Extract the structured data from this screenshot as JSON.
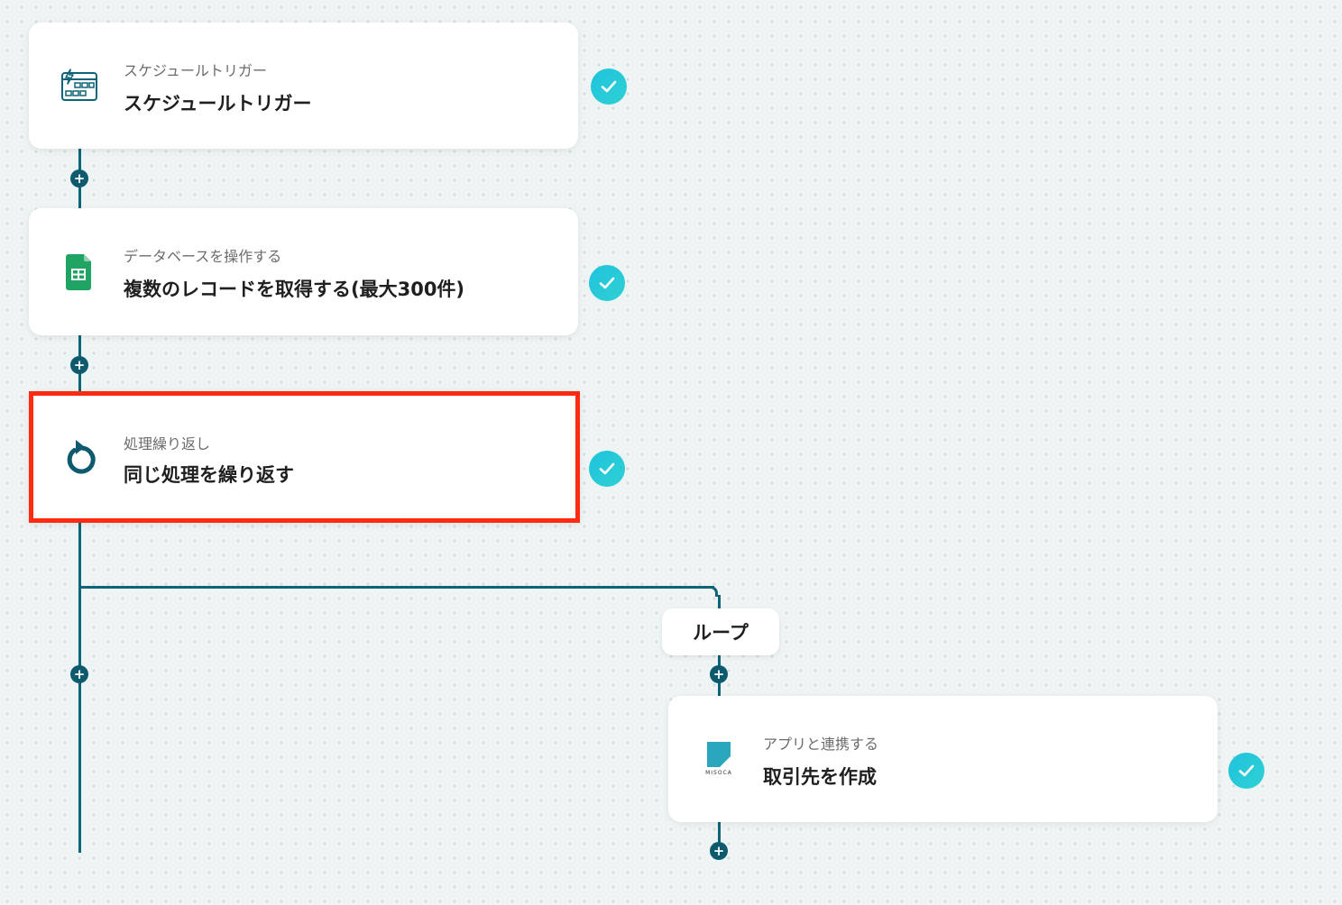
{
  "flow": {
    "steps": [
      {
        "subtitle": "スケジュールトリガー",
        "title": "スケジュールトリガー",
        "icon": "calendar-trigger-icon",
        "status": "completed"
      },
      {
        "subtitle": "データベースを操作する",
        "title": "複数のレコードを取得する(最大300件)",
        "icon": "google-sheets-icon",
        "status": "completed"
      },
      {
        "subtitle": "処理繰り返し",
        "title": "同じ処理を繰り返す",
        "icon": "loop-arrow-icon",
        "status": "completed",
        "highlighted": true
      },
      {
        "subtitle": "アプリと連携する",
        "title": "取引先を作成",
        "icon": "misoca-logo-icon",
        "status": "completed"
      }
    ],
    "loop_label": "ループ",
    "misoca_logo_text": "MISOCA"
  },
  "colors": {
    "connector": "#0d6377",
    "check_badge": "#1fc3dc",
    "highlight_border": "#ff2b10",
    "sheets_green": "#1fa463",
    "misoca_teal": "#2aa6bd"
  }
}
